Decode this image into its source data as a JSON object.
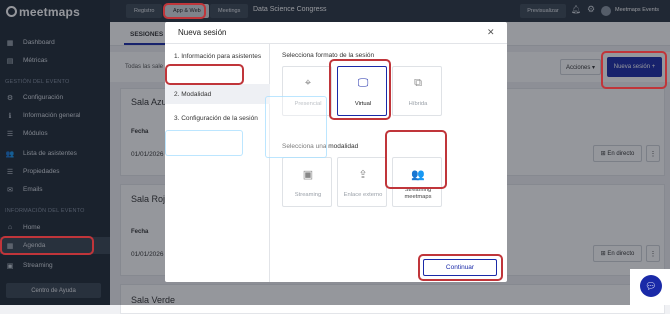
{
  "app": {
    "logo": "meetmaps"
  },
  "sidebar": {
    "items": [
      {
        "label": "Dashboard",
        "icon": "dashboard-icon",
        "glyph": "▦"
      },
      {
        "label": "Métricas",
        "icon": "metrics-icon",
        "glyph": "▤"
      },
      {
        "label": "Configuración",
        "icon": "gear-icon",
        "glyph": "⚙"
      },
      {
        "label": "Información general",
        "icon": "info-icon",
        "glyph": "ℹ"
      },
      {
        "label": "Módulos",
        "icon": "modules-icon",
        "glyph": "☰"
      },
      {
        "label": "Lista de asistentes",
        "icon": "users-icon",
        "glyph": "👥"
      },
      {
        "label": "Propiedades",
        "icon": "properties-icon",
        "glyph": "☰"
      },
      {
        "label": "Emails",
        "icon": "email-icon",
        "glyph": "✉"
      },
      {
        "label": "Home",
        "icon": "home-icon",
        "glyph": "⌂"
      },
      {
        "label": "Agenda",
        "icon": "calendar-icon",
        "glyph": "▦"
      },
      {
        "label": "Streaming",
        "icon": "streaming-icon",
        "glyph": "▣"
      }
    ],
    "section_event": "Gestión del evento",
    "section_info": "Información del evento",
    "help": "Centro de Ayuda"
  },
  "topbar": {
    "registro": "Registro",
    "app_web": "App & Web",
    "meetings": "Meetings",
    "event_name": "Data Science Congress",
    "preview": "Previsualizar",
    "user": "Meetmaps Events"
  },
  "main": {
    "tab": "SESIONES",
    "filter": "Todas las sale",
    "acciones": "Acciones ▾",
    "nueva_sesion": "Nueva sesión  +",
    "cards": [
      {
        "title": "Sala Azul",
        "label": "Fecha",
        "date": "01/01/2026",
        "live": "⊞ En directo",
        "more": "⋮"
      },
      {
        "title": "Sala Roja",
        "label": "Fecha",
        "date": "01/01/2026",
        "live": "⊞ En directo",
        "more": "⋮"
      },
      {
        "title": "Sala Verde"
      }
    ]
  },
  "modal": {
    "title": "Nueva sesión",
    "close": "✕",
    "steps": [
      "1. Información para asistentes",
      "2. Modalidad",
      "3. Configuración de la sesión"
    ],
    "format_title": "Selecciona formato de la sesión",
    "formats": [
      {
        "label": "Presencial",
        "glyph": "⌖",
        "icon": "location-pin-icon"
      },
      {
        "label": "Virtual",
        "glyph": "🖵",
        "icon": "monitor-icon"
      },
      {
        "label": "Híbrida",
        "glyph": "⧉",
        "icon": "hybrid-icon"
      }
    ],
    "modality_title": "Selecciona una modalidad",
    "modalities": [
      {
        "label": "Streaming",
        "glyph": "▣",
        "icon": "video-icon"
      },
      {
        "label": "Enlace externo",
        "glyph": "⇪",
        "icon": "share-icon"
      },
      {
        "label": "Streaming meetmaps",
        "glyph": "👥",
        "icon": "group-icon"
      }
    ],
    "continue": "Continuar"
  },
  "colors": {
    "accent": "#1a2aa8",
    "annotation": "#c0353a",
    "sidebar": "#1f2a36"
  }
}
